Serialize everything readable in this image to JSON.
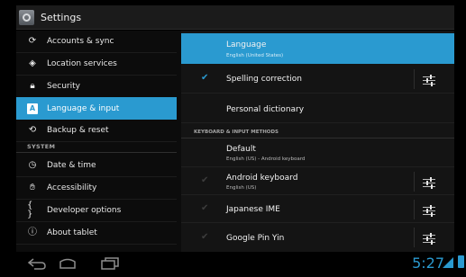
{
  "header": {
    "title": "Settings"
  },
  "sidebar": {
    "items": [
      {
        "label": "Accounts & sync",
        "icon": "sync-icon"
      },
      {
        "label": "Location services",
        "icon": "location-icon"
      },
      {
        "label": "Security",
        "icon": "lock-icon"
      },
      {
        "label": "Language & input",
        "icon": "language-icon",
        "selected": true
      },
      {
        "label": "Backup & reset",
        "icon": "backup-icon"
      },
      {
        "label": "Date & time",
        "icon": "clock-icon"
      },
      {
        "label": "Accessibility",
        "icon": "hand-icon"
      },
      {
        "label": "Developer options",
        "icon": "braces-icon"
      },
      {
        "label": "About tablet",
        "icon": "info-icon"
      }
    ],
    "section_system": "SYSTEM"
  },
  "detail": {
    "language": {
      "title": "Language",
      "subtitle": "English (United States)"
    },
    "spelling": {
      "title": "Spelling correction",
      "checked": true
    },
    "dictionary": {
      "title": "Personal dictionary"
    },
    "category": "KEYBOARD & INPUT METHODS",
    "default": {
      "title": "Default",
      "subtitle": "English (US) - Android keyboard"
    },
    "android_keyboard": {
      "title": "Android keyboard",
      "subtitle": "English (US)",
      "checked": false
    },
    "japanese_ime": {
      "title": "Japanese IME",
      "checked": false
    },
    "google_pinyin": {
      "title": "Google Pin Yin",
      "checked": false
    }
  },
  "status": {
    "clock": "5:27"
  },
  "colors": {
    "accent": "#2a9ad0",
    "background": "#000000"
  }
}
